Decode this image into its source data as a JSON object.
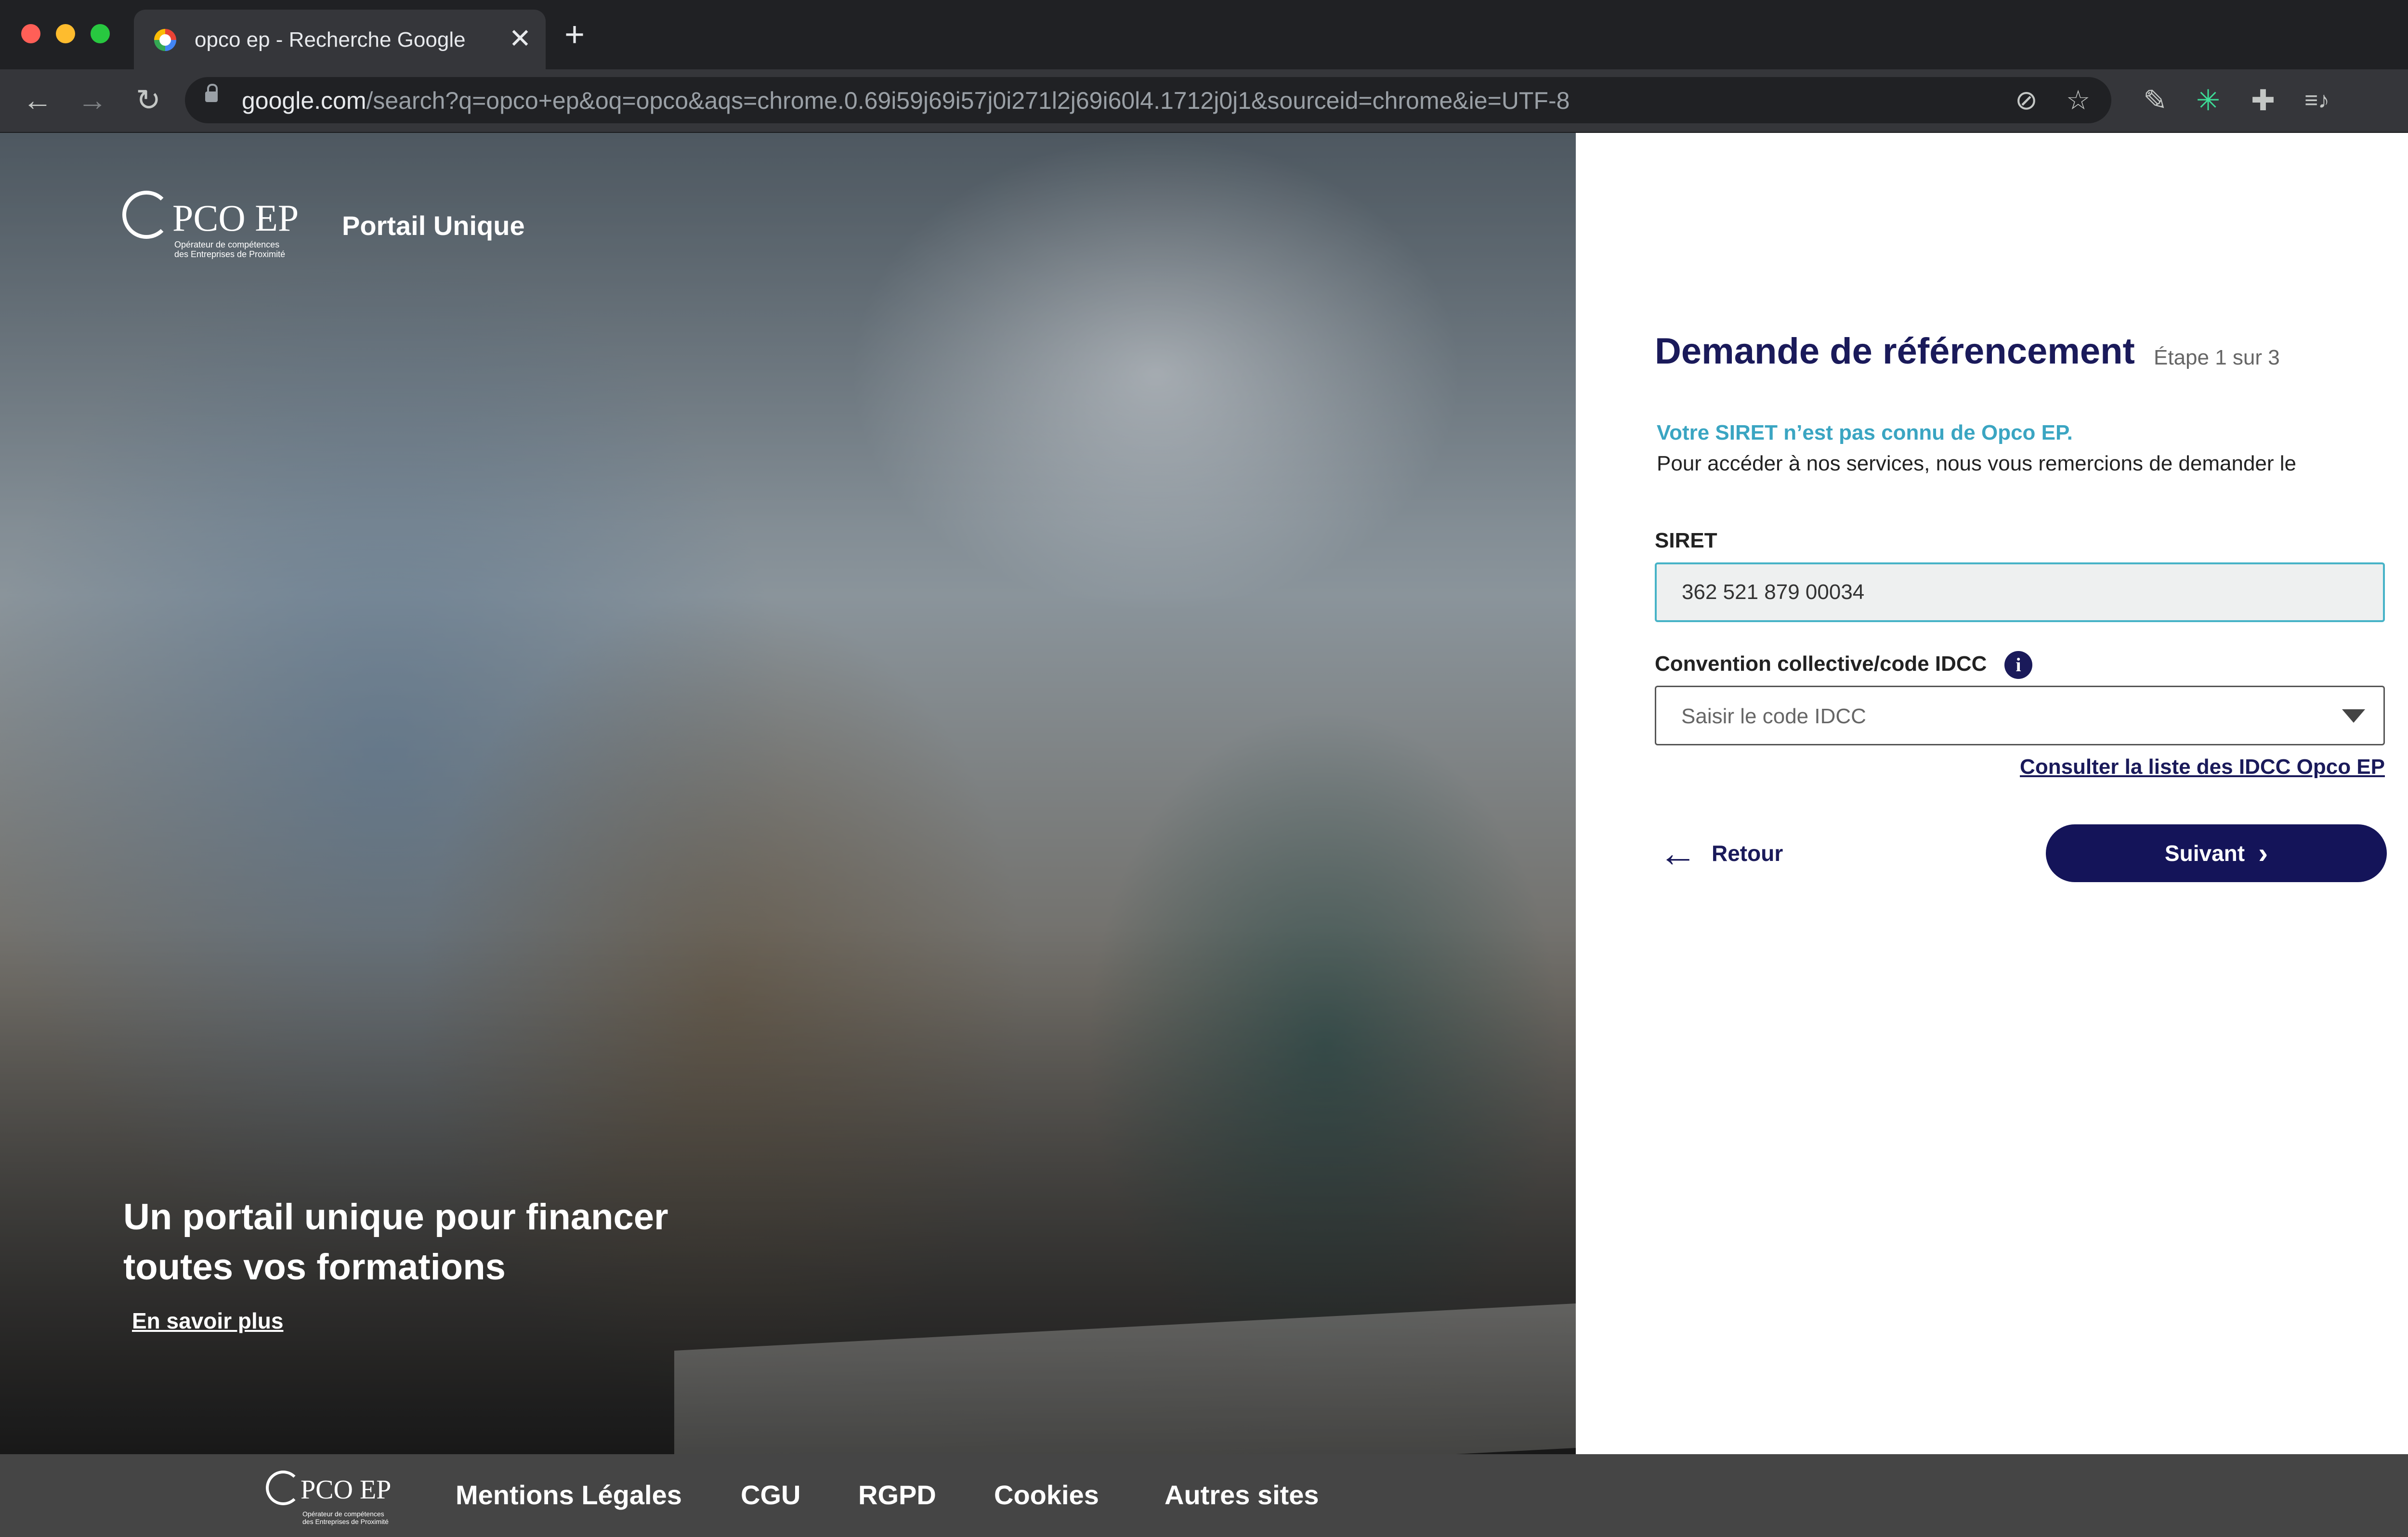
{
  "browser": {
    "tab_title": "opco ep - Recherche Google",
    "tab_close": "✕",
    "new_tab": "+",
    "url_host": "google.com",
    "url_path": "/search?q=opco+ep&oq=opco&aqs=chrome.0.69i59j69i57j0i271l2j69i60l4.1712j0j1&sourceid=chrome&ie=UTF-8",
    "traffic_colors": [
      "#ff5f57",
      "#febc2e",
      "#28c840"
    ],
    "icons": {
      "back": "←",
      "forward": "→",
      "reload": "↻",
      "tracking": "⊘",
      "star": "☆",
      "pen": "✎",
      "ext": "✳",
      "puzzle": "✚",
      "media": "≡♪",
      "menu": "⋮",
      "tab_search": "▾"
    }
  },
  "hero": {
    "logo_text": "PCO EP",
    "logo_sub_1": "Opérateur de compétences",
    "logo_sub_2": "des Entreprises de Proximité",
    "portal_label": "Portail Unique",
    "headline_1": "Un portail unique pour financer",
    "headline_2": "toutes vos formations",
    "learn_more": "En savoir plus"
  },
  "form": {
    "title": "Demande de référencement",
    "step": "Étape 1 sur 3",
    "alert_title": "Votre SIRET n’est pas connu de Opco EP.",
    "alert_body": "Pour accéder à nos services, nous vous remercions de demander le",
    "siret_label": "SIRET",
    "siret_value": "362 521 879 00034",
    "idcc_label": "Convention collective/code IDCC",
    "info_glyph": "i",
    "idcc_placeholder": "Saisir le code IDCC",
    "idcc_link": "Consulter la liste des IDCC Opco EP",
    "back_arrow": "←",
    "back_label": "Retour",
    "next_label": "Suivant",
    "next_chevron": "›"
  },
  "footer": {
    "logo_text": "PCO EP",
    "logo_sub_1": "Opérateur de compétences",
    "logo_sub_2": "des Entreprises de Proximité",
    "links": [
      "Mentions Légales",
      "CGU",
      "RGPD",
      "Cookies",
      "Autres sites"
    ]
  },
  "colors": {
    "brand_navy": "#141459",
    "accent_teal": "#3aa5c2",
    "footer_bg": "#454545"
  }
}
